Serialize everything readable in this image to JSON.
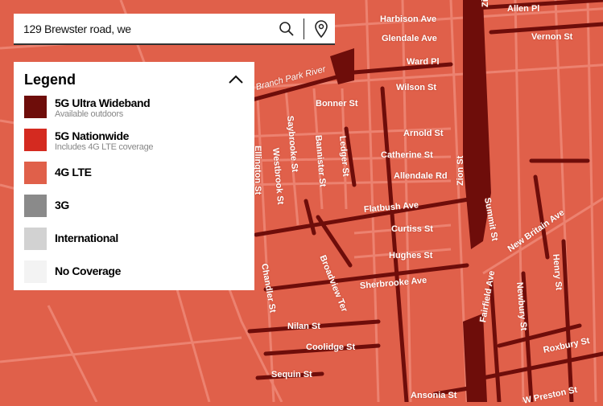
{
  "search": {
    "value": "129 Brewster road, we",
    "search_icon": "search-icon",
    "location_icon": "location-pin-icon"
  },
  "legend": {
    "title": "Legend",
    "toggle_icon": "chevron-up-icon",
    "items": [
      {
        "label": "5G Ultra Wideband",
        "sub": "Available outdoors",
        "color": "#6e0d0a"
      },
      {
        "label": "5G Nationwide",
        "sub": "Includes 4G LTE coverage",
        "color": "#d42a20"
      },
      {
        "label": "4G LTE",
        "color": "#e0604a"
      },
      {
        "label": "3G",
        "color": "#8a8a8a"
      },
      {
        "label": "International",
        "color": "#d2d2d2"
      },
      {
        "label": "No Coverage",
        "color": "#f3f3f3"
      }
    ]
  },
  "map": {
    "colors": {
      "lte": "#e0604a",
      "road": "#ec8270",
      "uw": "#6e0d0a"
    },
    "streets": [
      "Harbison Ave",
      "Allen Pl",
      "Glendale Ave",
      "Vernon St",
      "Ward Pl",
      "Wilson St",
      "Bonner St",
      "Arnold St",
      "Catherine St",
      "Allendale Rd",
      "Flatbush Ave",
      "Curtiss St",
      "Hughes St",
      "Sherbrooke Ave",
      "Nilan St",
      "Coolidge St",
      "Sequin St",
      "Ansonia St",
      "Roxbury St",
      "W Preston St",
      "New Britain Ave",
      "Zion St",
      "Summit St",
      "Fairfield Ave",
      "Newbury St",
      "Henry St",
      "Ellington St",
      "Westbrook St",
      "Saybrooke St",
      "Bannister St",
      "Ledger St",
      "Chandler St",
      "Broadview Ter",
      "Branch Park River",
      "Zion"
    ]
  }
}
